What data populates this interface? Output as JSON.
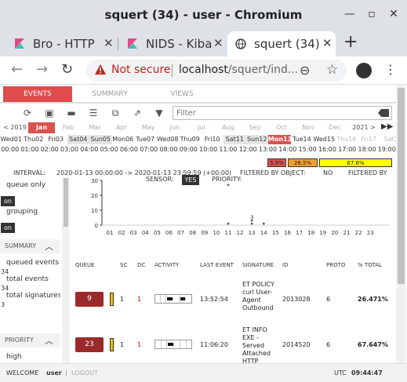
{
  "browser": {
    "window_title": "squert (34) - user - Chromium",
    "tabs": [
      {
        "label": "Bro - HTTP",
        "active": false
      },
      {
        "label": "NIDS - Kiba",
        "active": false
      },
      {
        "label": "squert (34)",
        "active": true
      }
    ],
    "security_label": "Not secure",
    "url_host": "localhost",
    "url_rest": "/squert/ind..."
  },
  "app": {
    "tabs": [
      "EVENTS",
      "SUMMARY",
      "VIEWS"
    ],
    "filter_placeholder": "Filter",
    "calendar": {
      "prev": "< 2019",
      "months": [
        "Jan",
        "Feb",
        "Mar",
        "Apr",
        "May",
        "Jun",
        "Jul",
        "Aug",
        "Sep",
        "Oct",
        "Nov",
        "Dec"
      ],
      "next": "2021 >",
      "days": [
        "Wed01",
        "Thu02",
        "Fri03",
        "Sat04",
        "Sun05",
        "Mon06",
        "Tue07",
        "Wed08",
        "Thu09",
        "Fri10",
        "Sat11",
        "Sun12",
        "Mon13",
        "Tue14",
        "Wed15",
        "Thu16",
        "Fri17",
        "Sat1"
      ],
      "hours": [
        "00:00",
        "01:00",
        "02:00",
        "03:00",
        "04:00",
        "05:00",
        "06:00",
        "07:00",
        "08:00",
        "09:00",
        "10:00",
        "11:00",
        "12:00",
        "13:00",
        "14:00",
        "15:00",
        "16:00",
        "17:00",
        "18:00",
        "19:00"
      ]
    },
    "breakdown": [
      {
        "label": "5.9%",
        "color": "#d9534f",
        "value": 5.9
      },
      {
        "label": "26.5%",
        "color": "#f0a030",
        "value": 26.5
      },
      {
        "label": "67.6%",
        "color": "#ffff00",
        "value": 67.6
      }
    ],
    "info": {
      "interval_label": "INTERVAL:",
      "interval_value": "2020-01-13 00:00:00 -> 2020-01-13 23:59:59 (+00:00)",
      "filtered_by_object_label": "FILTERED BY OBJECT:",
      "filtered_by_object_value": "NO",
      "filtered_by_label": "FILTERED BY",
      "sensor_label": "SENSOR:",
      "sensor_value": "YES",
      "priority_label": "PRIORITY:"
    },
    "left_panel": {
      "queue_only": "queue only",
      "queue_only_state": "on",
      "grouping": "grouping",
      "grouping_state": "on",
      "summary_header": "SUMMARY",
      "queued_events_label": "queued events",
      "queued_events_value": "34",
      "total_events_label": "total events",
      "total_events_value": "34",
      "total_signatures_label": "total signatures",
      "total_signatures_value": "3",
      "priority_header": "PRIORITY",
      "high_label": "high"
    },
    "table": {
      "headers": [
        "QUEUE",
        "SC",
        "DC",
        "ACTIVITY",
        "LAST EVENT",
        "SIGNATURE",
        "ID",
        "PROTO",
        "% TOTAL"
      ],
      "rows": [
        {
          "queue": "9",
          "sc": "1",
          "dc": "1",
          "last_event": "13:52:54",
          "signature": "ET POLICY curl User-Agent Outbound",
          "id": "2013028",
          "proto": "6",
          "pct_total": "26.471%",
          "activity": [
            0,
            0,
            1,
            0,
            1,
            0
          ]
        },
        {
          "queue": "23",
          "sc": "1",
          "dc": "1",
          "last_event": "11:06:20",
          "signature": "ET INFO EXE - Served Attached HTTP",
          "id": "2014520",
          "proto": "6",
          "pct_total": "67.647%",
          "activity": [
            0,
            0,
            1,
            0,
            0,
            0
          ]
        }
      ]
    },
    "footer": {
      "welcome": "WELCOME",
      "user": "user",
      "sep": "|",
      "logout": "LOGOUT",
      "tz": "UTC",
      "time": "09:44:47"
    }
  },
  "chart_data": {
    "type": "scatter",
    "title": "",
    "xlabel": "",
    "ylabel": "",
    "x": [
      "01",
      "02",
      "03",
      "04",
      "05",
      "06",
      "07",
      "08",
      "09",
      "10",
      "11",
      "12",
      "13",
      "14",
      "15",
      "16",
      "17",
      "18",
      "19",
      "20",
      "21",
      "22",
      "23"
    ],
    "ylim": [
      0,
      30
    ],
    "yticks": [
      0,
      10,
      20,
      30
    ],
    "points": [
      {
        "x": "11",
        "y": 27
      },
      {
        "x": "11",
        "y": 1
      },
      {
        "x": "13",
        "y": 3
      },
      {
        "x": "13",
        "y": 1
      },
      {
        "x": "14",
        "y": 1
      }
    ],
    "annotations": [
      {
        "x": "13",
        "y": 3,
        "text": "3"
      }
    ]
  }
}
